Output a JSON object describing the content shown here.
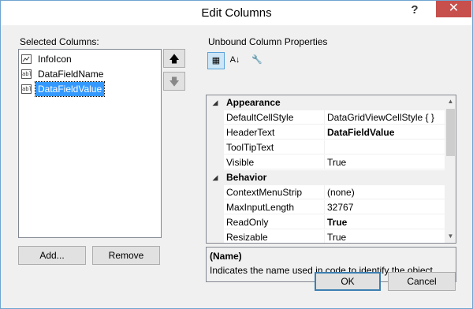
{
  "window": {
    "title": "Edit Columns",
    "help": "?",
    "close": "✕"
  },
  "left": {
    "label": "Selected Columns:",
    "columns": [
      {
        "label": "InfoIcon",
        "icon": "image-column-icon"
      },
      {
        "label": "DataFieldName",
        "icon": "textbox-column-icon"
      },
      {
        "label": "DataFieldValue",
        "icon": "textbox-column-icon",
        "selected": true
      }
    ],
    "add_label": "Add...",
    "remove_label": "Remove"
  },
  "right": {
    "label": "Unbound Column Properties",
    "categories": [
      {
        "name": "Appearance",
        "props": [
          {
            "name": "DefaultCellStyle",
            "value": "DataGridViewCellStyle { }",
            "bold": false
          },
          {
            "name": "HeaderText",
            "value": "DataFieldValue",
            "bold": true
          },
          {
            "name": "ToolTipText",
            "value": "",
            "bold": false
          },
          {
            "name": "Visible",
            "value": "True",
            "bold": false
          }
        ]
      },
      {
        "name": "Behavior",
        "props": [
          {
            "name": "ContextMenuStrip",
            "value": "(none)",
            "bold": false
          },
          {
            "name": "MaxInputLength",
            "value": "32767",
            "bold": false
          },
          {
            "name": "ReadOnly",
            "value": "True",
            "bold": true
          },
          {
            "name": "Resizable",
            "value": "True",
            "bold": false
          }
        ]
      }
    ],
    "description": {
      "title": "(Name)",
      "text": "Indicates the name used in code to identify the object."
    }
  },
  "footer": {
    "ok_label": "OK",
    "cancel_label": "Cancel"
  }
}
